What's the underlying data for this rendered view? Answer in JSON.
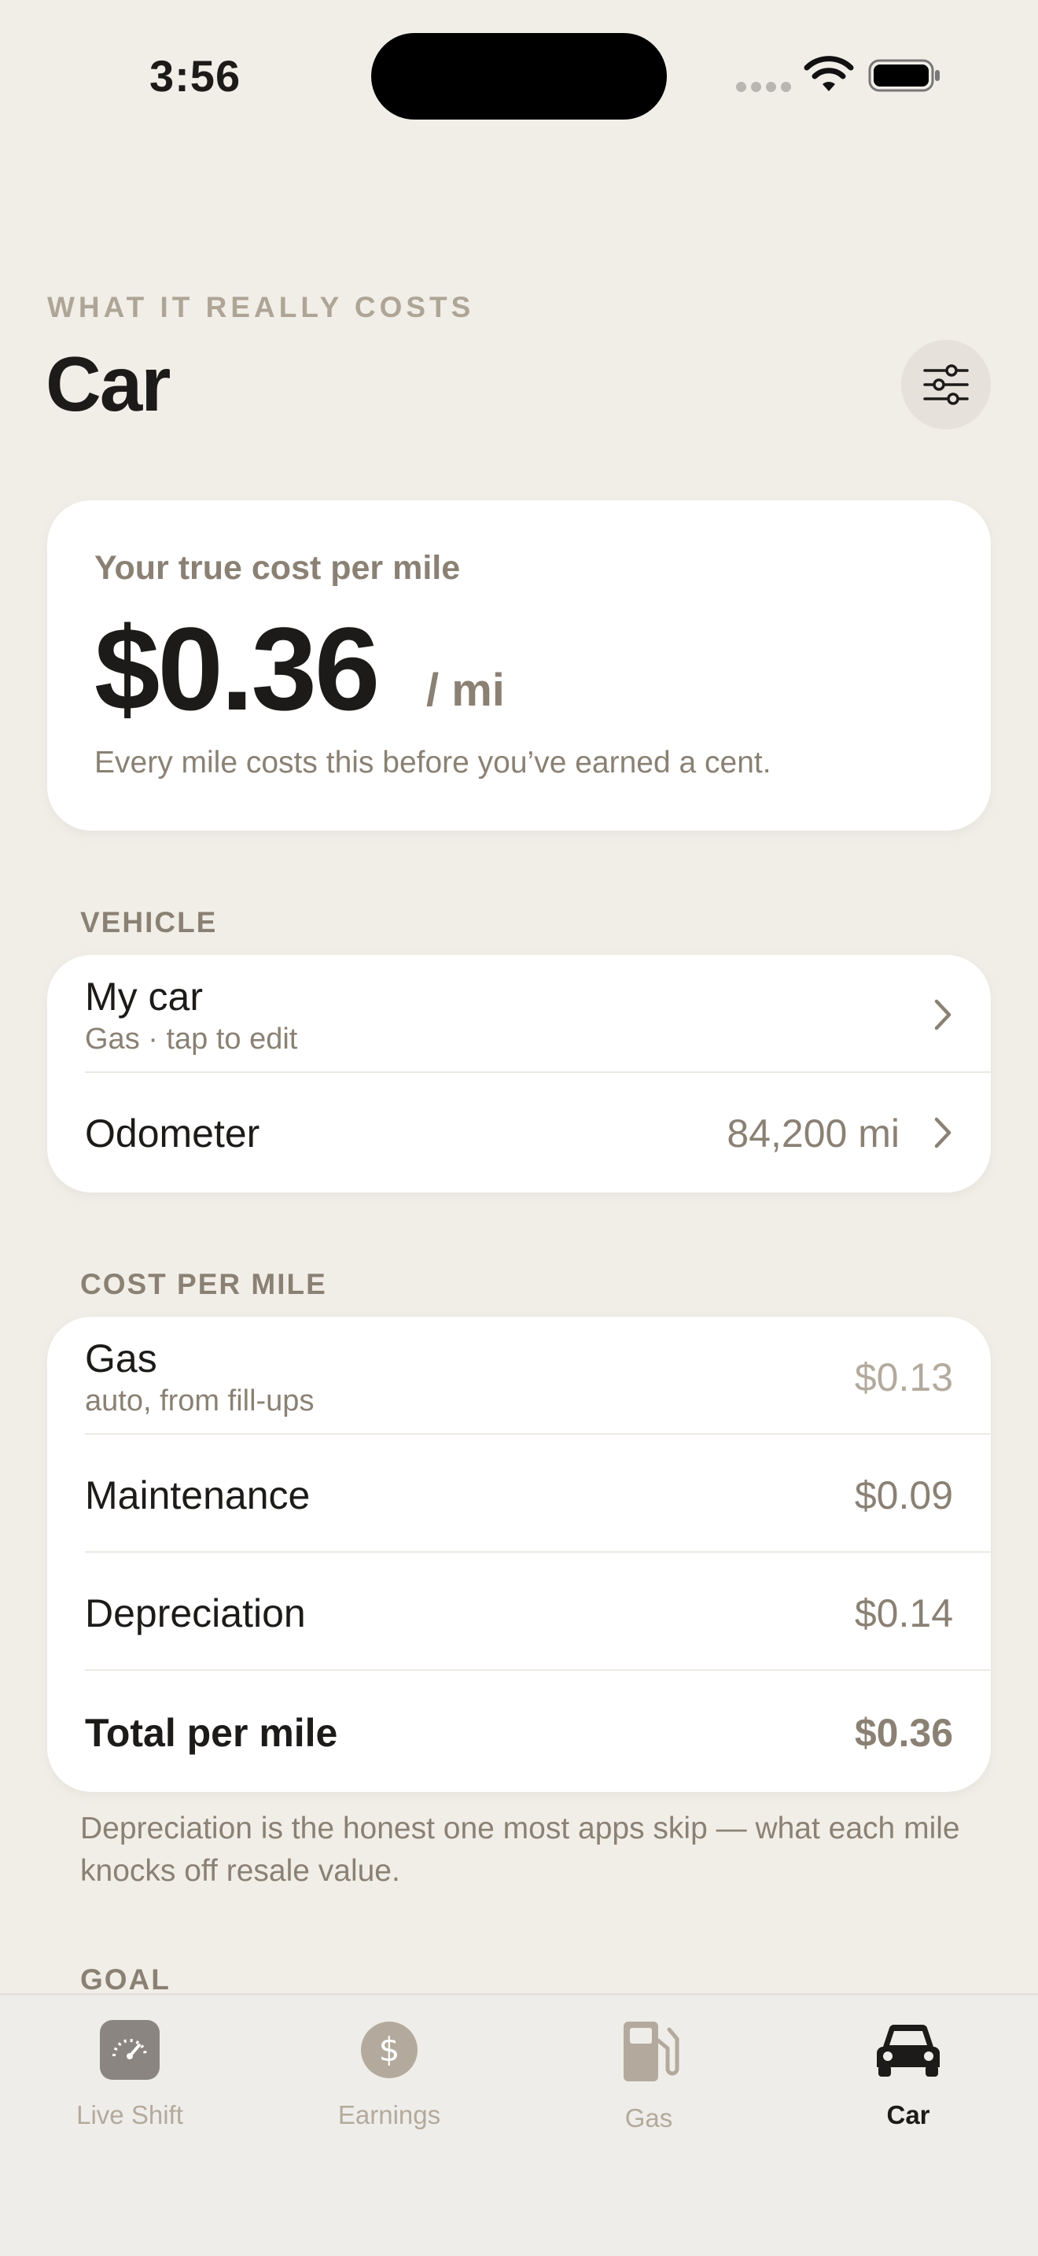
{
  "status_bar": {
    "time": "3:56"
  },
  "header": {
    "eyebrow": "WHAT IT REALLY COSTS",
    "title": "Car",
    "settings_icon": "sliders-icon"
  },
  "hero": {
    "label": "Your true cost per mile",
    "value": "$0.36",
    "unit": "/ mi",
    "note": "Every mile costs this before you’ve earned a cent."
  },
  "vehicle": {
    "header": "VEHICLE",
    "rows": [
      {
        "title": "My car",
        "subtitle": "Gas · tap to edit",
        "value": ""
      },
      {
        "title": "Odometer",
        "value": "84,200 mi"
      }
    ]
  },
  "cost_per_mile": {
    "header": "COST PER MILE",
    "rows": [
      {
        "title": "Gas",
        "subtitle": "auto, from fill-ups",
        "value": "$0.13"
      },
      {
        "title": "Maintenance",
        "value": "$0.09"
      },
      {
        "title": "Depreciation",
        "value": "$0.14"
      },
      {
        "title": "Total per mile",
        "value": "$0.36"
      }
    ],
    "footnote": "Depreciation is the honest one most apps skip — what each mile knocks off resale value."
  },
  "goal": {
    "header": "GOAL"
  },
  "tabbar": {
    "tabs": [
      {
        "label": "Live Shift",
        "icon": "speedometer-icon",
        "active": false
      },
      {
        "label": "Earnings",
        "icon": "dollar-icon",
        "active": false
      },
      {
        "label": "Gas",
        "icon": "fuel-pump-icon",
        "active": false
      },
      {
        "label": "Car",
        "icon": "car-icon",
        "active": true
      }
    ]
  },
  "colors": {
    "background": "#f1eee8",
    "card": "#ffffff",
    "text_primary": "#1d1b19",
    "text_secondary": "#8a8174",
    "text_muted": "#b3aa9d"
  }
}
